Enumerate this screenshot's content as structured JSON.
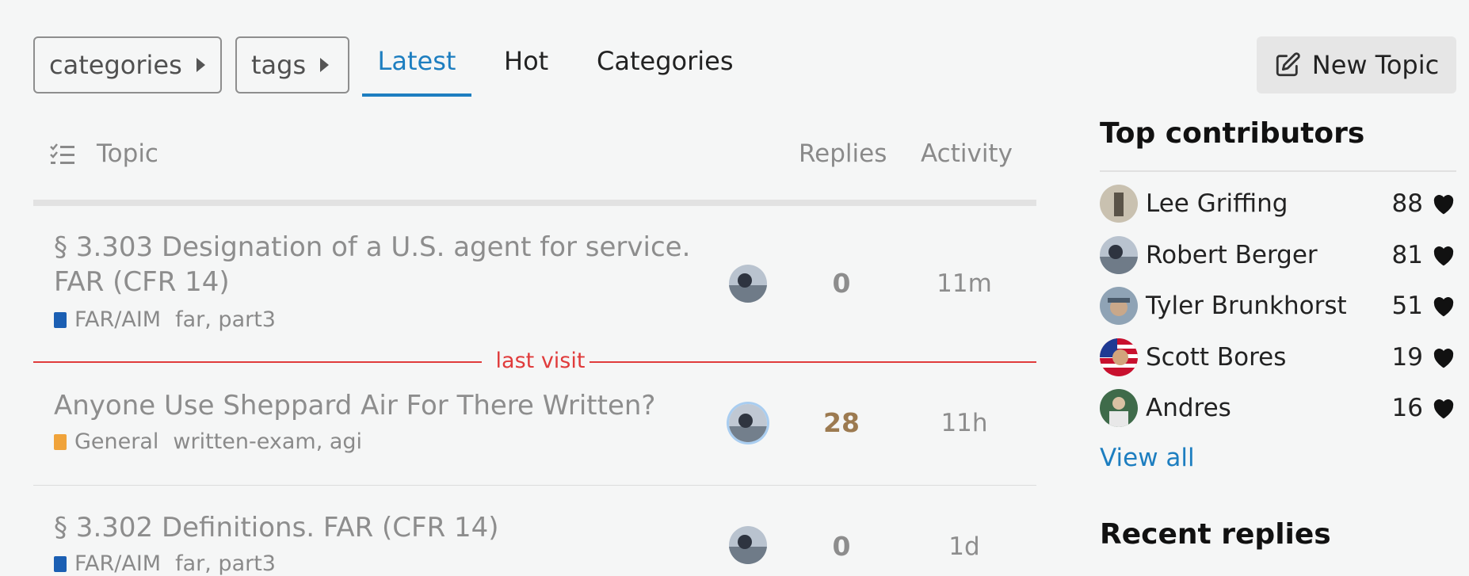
{
  "nav": {
    "categories_dropdown": "categories",
    "tags_dropdown": "tags",
    "tabs": [
      {
        "label": "Latest",
        "active": true
      },
      {
        "label": "Hot",
        "active": false
      },
      {
        "label": "Categories",
        "active": false
      }
    ],
    "new_topic_label": "New Topic"
  },
  "table": {
    "headers": {
      "topic": "Topic",
      "replies": "Replies",
      "activity": "Activity"
    },
    "last_visit_label": "last visit",
    "topics": [
      {
        "title_line1": "§ 3.303 Designation of a U.S. agent for service.",
        "title_line2": "FAR (CFR 14)",
        "category": "FAR/AIM",
        "category_color": "#1b5fb3",
        "tags": "far, part3",
        "replies": "0",
        "activity": "11m"
      },
      {
        "title_line1": "Anyone Use Sheppard Air For There Written?",
        "category": "General",
        "category_color": "#f0a33a",
        "tags": "written-exam, agi",
        "replies": "28",
        "replies_color": "#9c7a50",
        "activity": "11h"
      },
      {
        "title_line1": "§ 3.302 Definitions. FAR (CFR 14)",
        "category": "FAR/AIM",
        "category_color": "#1b5fb3",
        "tags": "far, part3",
        "replies": "0",
        "activity": "1d"
      }
    ]
  },
  "sidebar": {
    "top_contributors_title": "Top contributors",
    "contributors": [
      {
        "name": "Lee Griffing",
        "count": "88"
      },
      {
        "name": "Robert Berger",
        "count": "81"
      },
      {
        "name": "Tyler Brunkhorst",
        "count": "51"
      },
      {
        "name": "Scott Bores",
        "count": "19"
      },
      {
        "name": "Andres",
        "count": "16"
      }
    ],
    "view_all": "View all",
    "recent_replies_title": "Recent replies"
  },
  "colors": {
    "accent": "#1d7ec0",
    "last_visit": "#e03b3b"
  }
}
